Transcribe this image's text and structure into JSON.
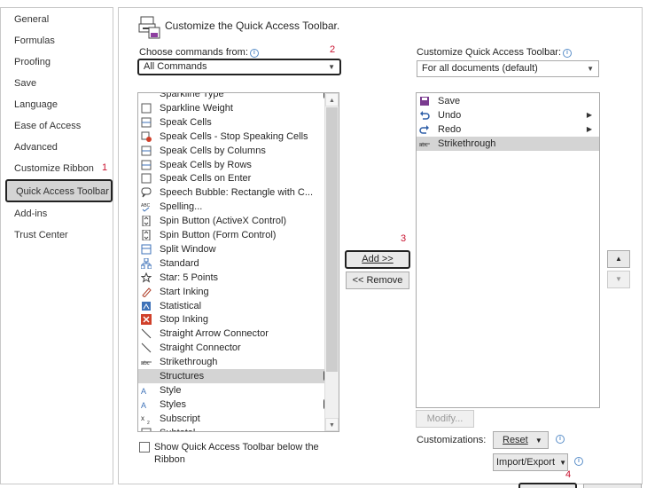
{
  "nav": {
    "items": [
      "General",
      "Formulas",
      "Proofing",
      "Save",
      "Language",
      "Ease of Access",
      "Advanced",
      "Customize Ribbon",
      "Quick Access Toolbar",
      "Add-ins",
      "Trust Center"
    ],
    "selected": "Quick Access Toolbar"
  },
  "markers": {
    "one": "1",
    "two": "2",
    "three": "3",
    "four": "4"
  },
  "main": {
    "heading": "Customize the Quick Access Toolbar.",
    "choose_label": "Choose commands from:",
    "choose_value": "All Commands",
    "customize_label": "Customize Quick Access Toolbar:",
    "customize_value": "For all documents (default)",
    "commands": [
      {
        "label": "Sparkline Type",
        "icon": "sparkline-type-icon",
        "expand": true
      },
      {
        "label": "Sparkline Weight",
        "icon": "line-weight-icon",
        "submenu": true
      },
      {
        "label": "Speak Cells",
        "icon": "speak-cells-icon"
      },
      {
        "label": "Speak Cells - Stop Speaking Cells",
        "icon": "stop-speaking-icon"
      },
      {
        "label": "Speak Cells by Columns",
        "icon": "speak-columns-icon"
      },
      {
        "label": "Speak Cells by Rows",
        "icon": "speak-rows-icon"
      },
      {
        "label": "Speak Cells on Enter",
        "icon": "speak-enter-icon"
      },
      {
        "label": "Speech Bubble: Rectangle with C...",
        "icon": "speech-bubble-icon"
      },
      {
        "label": "Spelling...",
        "icon": "spelling-icon"
      },
      {
        "label": "Spin Button (ActiveX Control)",
        "icon": "spin-button-icon"
      },
      {
        "label": "Spin Button (Form Control)",
        "icon": "spin-button-form-icon"
      },
      {
        "label": "Split Window",
        "icon": "split-window-icon"
      },
      {
        "label": "Standard",
        "icon": "standard-icon"
      },
      {
        "label": "Star: 5 Points",
        "icon": "star-icon"
      },
      {
        "label": "Start Inking",
        "icon": "inking-icon"
      },
      {
        "label": "Statistical",
        "icon": "statistical-icon",
        "submenu": true
      },
      {
        "label": "Stop Inking",
        "icon": "stop-inking-icon"
      },
      {
        "label": "Straight Arrow Connector",
        "icon": "arrow-connector-icon"
      },
      {
        "label": "Straight Connector",
        "icon": "connector-icon"
      },
      {
        "label": "Strikethrough",
        "icon": "strikethrough-icon"
      },
      {
        "label": "Structures",
        "icon": "structures-icon",
        "expand": true,
        "selected": true
      },
      {
        "label": "Style",
        "icon": "style-icon",
        "submenu": true
      },
      {
        "label": "Styles",
        "icon": "styles-icon",
        "expand": true
      },
      {
        "label": "Subscript",
        "icon": "subscript-icon"
      },
      {
        "label": "Subtotal",
        "icon": "subtotal-icon"
      }
    ],
    "toolbar_items": [
      {
        "label": "Save",
        "icon": "save-icon"
      },
      {
        "label": "Undo",
        "icon": "undo-icon",
        "submenu": true
      },
      {
        "label": "Redo",
        "icon": "redo-icon",
        "submenu": true
      },
      {
        "label": "Strikethrough",
        "icon": "strikethrough-icon",
        "selected": true
      }
    ],
    "add_label": "Add >>",
    "remove_label": "<< Remove",
    "show_below_label_1": "Show Quick Access Toolbar below the",
    "show_below_label_2": "Ribbon",
    "modify_label": "Modify...",
    "customizations_label": "Customizations:",
    "reset_label": "Reset",
    "import_export_label": "Import/Export"
  }
}
